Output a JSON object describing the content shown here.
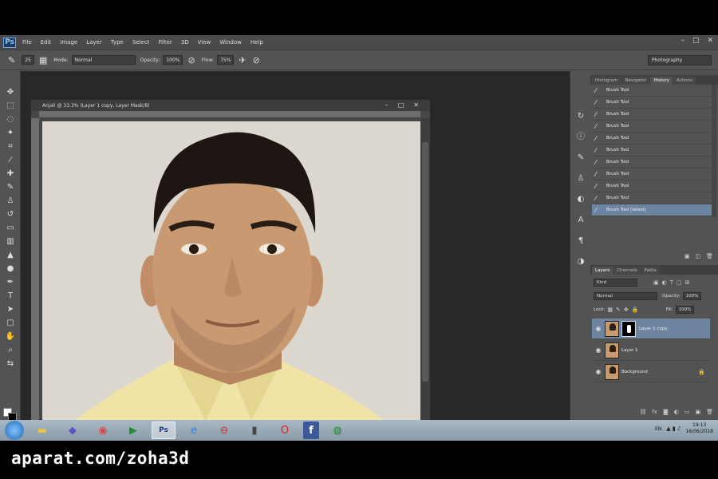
{
  "menubar": {
    "logo": "Ps",
    "items": [
      "File",
      "Edit",
      "Image",
      "Layer",
      "Type",
      "Select",
      "Filter",
      "3D",
      "View",
      "Window",
      "Help"
    ],
    "controls": [
      "–",
      "□",
      "✕"
    ]
  },
  "options_bar": {
    "brush_size": "25",
    "mode_label": "Mode:",
    "mode_value": "Normal",
    "opacity_label": "Opacity:",
    "opacity_value": "100%",
    "flow_label": "Flow:",
    "flow_value": "75%",
    "workspace": "Photography"
  },
  "document": {
    "title": "Anjali @ 33.3% (Layer 1 copy, Layer Mask/8)",
    "controls": [
      "–",
      "□",
      "✕"
    ]
  },
  "history": {
    "tabs": [
      "Histogram",
      "Navigator",
      "History",
      "Actions"
    ],
    "active_tab": "History",
    "items": [
      "Brush Tool",
      "Brush Tool",
      "Brush Tool",
      "Brush Tool",
      "Brush Tool",
      "Brush Tool",
      "Brush Tool",
      "Brush Tool",
      "Brush Tool",
      "Brush Tool",
      "Brush Tool (latest)"
    ]
  },
  "layers": {
    "tabs": [
      "Layers",
      "Channels",
      "Paths"
    ],
    "active_tab": "Layers",
    "kind": "Kind",
    "blend_mode": "Normal",
    "opacity_label": "Opacity:",
    "opacity_value": "100%",
    "lock_label": "Lock:",
    "fill_label": "Fill:",
    "fill_value": "100%",
    "items": [
      "Layer 1 copy",
      "Layer 1",
      "Background"
    ]
  },
  "taskbar": {
    "lang": "EN",
    "time": "19:13",
    "date": "16/06/2018"
  },
  "watermark": "aparat.com/zoha3d",
  "colors": {
    "ui_gray": "#535353",
    "canvas_dark": "#282828",
    "selection_blue": "#6d85a3",
    "photo_bg": "#dcd8d0",
    "shirt_yellow": "#efe3a6"
  }
}
